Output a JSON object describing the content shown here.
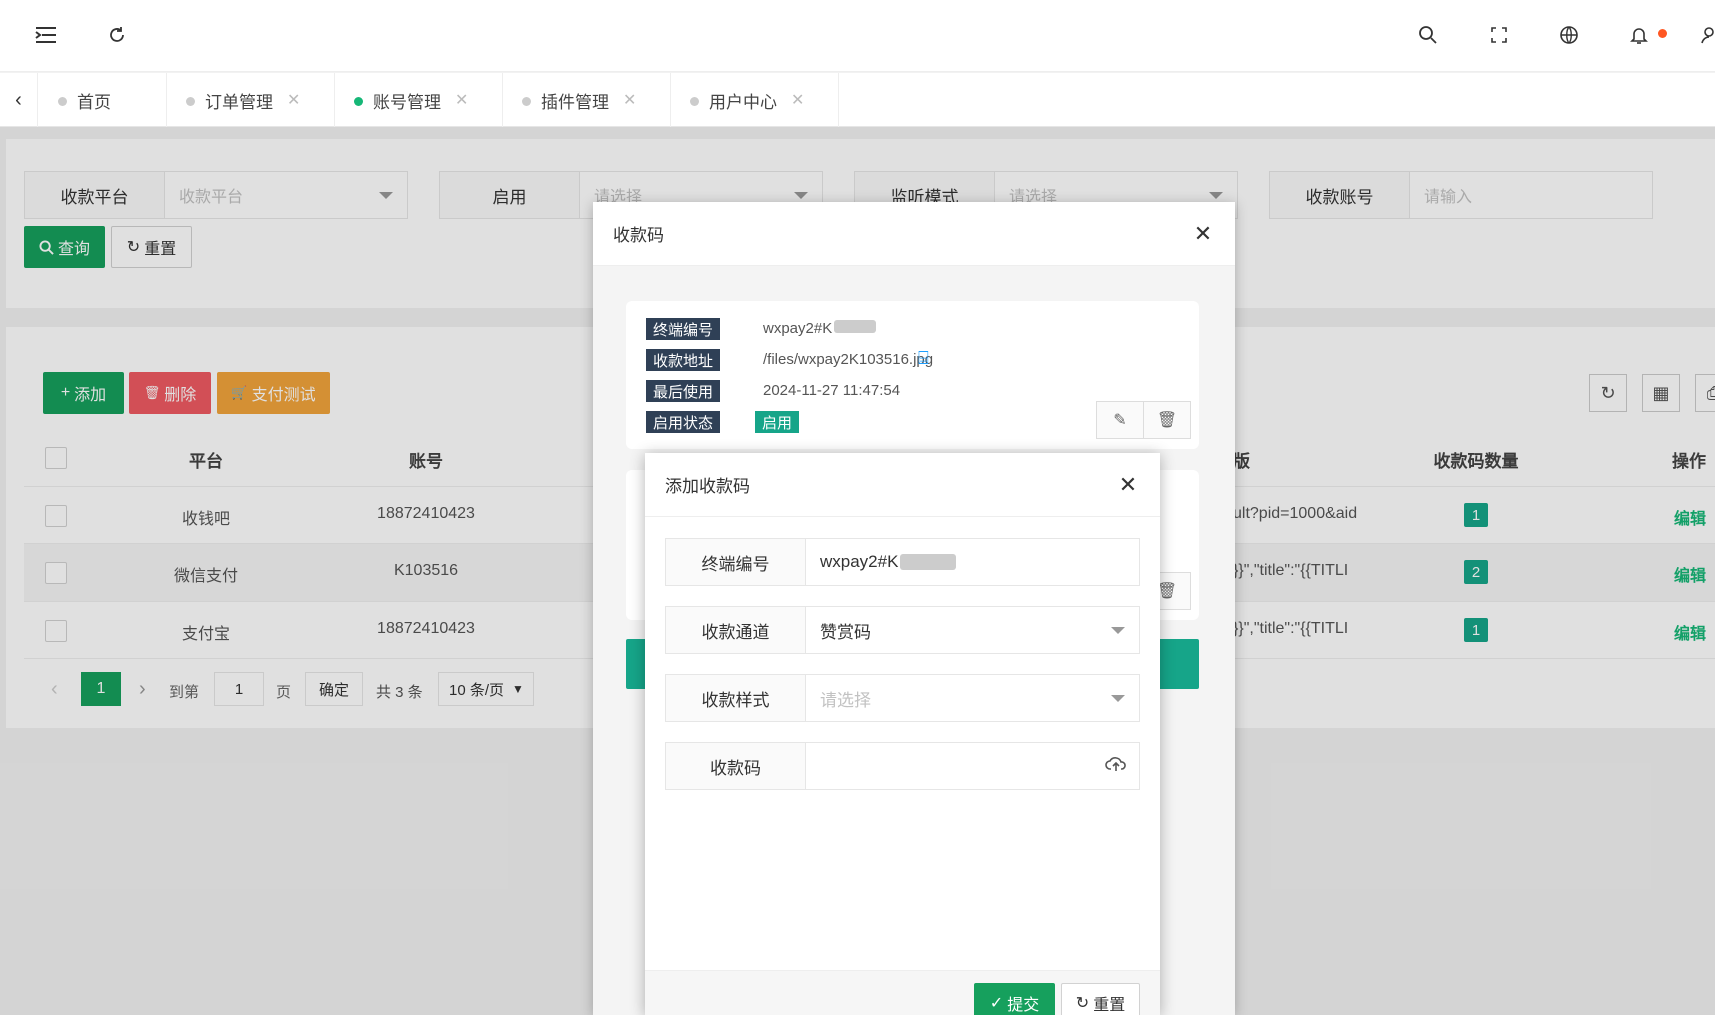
{
  "header": {
    "icons": [
      "menu-icon",
      "refresh-icon",
      "search-icon",
      "fullscreen-icon",
      "globe-icon",
      "bell-icon",
      "user-icon"
    ]
  },
  "tabs": [
    {
      "label": "首页",
      "closable": false,
      "active": false
    },
    {
      "label": "订单管理",
      "closable": true,
      "active": false
    },
    {
      "label": "账号管理",
      "closable": true,
      "active": true
    },
    {
      "label": "插件管理",
      "closable": true,
      "active": false
    },
    {
      "label": "用户中心",
      "closable": true,
      "active": false
    }
  ],
  "search": {
    "platform_label": "收款平台",
    "platform_placeholder": "收款平台",
    "enabled_label": "启用",
    "enabled_placeholder": "请选择",
    "listen_label": "监听模式",
    "listen_placeholder": "请选择",
    "account_label": "收款账号",
    "account_placeholder": "请输入",
    "query_btn": "查询",
    "reset_btn": "重置"
  },
  "toolbar": {
    "add": "添加",
    "delete": "删除",
    "pay_test": "支付测试"
  },
  "table": {
    "headers": {
      "platform": "平台",
      "account": "账号",
      "version": "版",
      "qr_count": "收款码数量",
      "action": "操作"
    },
    "rows": [
      {
        "platform": "收钱吧",
        "account": "18872410423",
        "extra": "ult?pid=1000&aid",
        "qr_count": "1",
        "action": "编辑"
      },
      {
        "platform": "微信支付",
        "account": "K103516",
        "extra": "}}\",\"title\":\"{{TITLI",
        "qr_count": "2",
        "action": "编辑"
      },
      {
        "platform": "支付宝",
        "account": "18872410423",
        "extra": "}}\",\"title\":\"{{TITLI",
        "qr_count": "1",
        "action": "编辑"
      }
    ]
  },
  "pager": {
    "current": "1",
    "goto": "到第",
    "page_input": "1",
    "page_unit": "页",
    "confirm": "确定",
    "total": "共 3 条",
    "per_page": "10 条/页"
  },
  "modal_qr": {
    "title": "收款码",
    "terminal_label": "终端编号",
    "terminal_value": "wxpay2#K",
    "url_label": "收款地址",
    "url_value": "/files/wxpay2K103516.jpg",
    "last_used_label": "最后使用",
    "last_used_value": "2024-11-27 11:47:54",
    "status_label": "启用状态",
    "status_value": "启用"
  },
  "modal_add": {
    "title": "添加收款码",
    "terminal_label": "终端编号",
    "terminal_value": "wxpay2#K",
    "channel_label": "收款通道",
    "channel_value": "赞赏码",
    "style_label": "收款样式",
    "style_placeholder": "请选择",
    "qr_label": "收款码",
    "submit": "提交",
    "reset": "重置"
  }
}
